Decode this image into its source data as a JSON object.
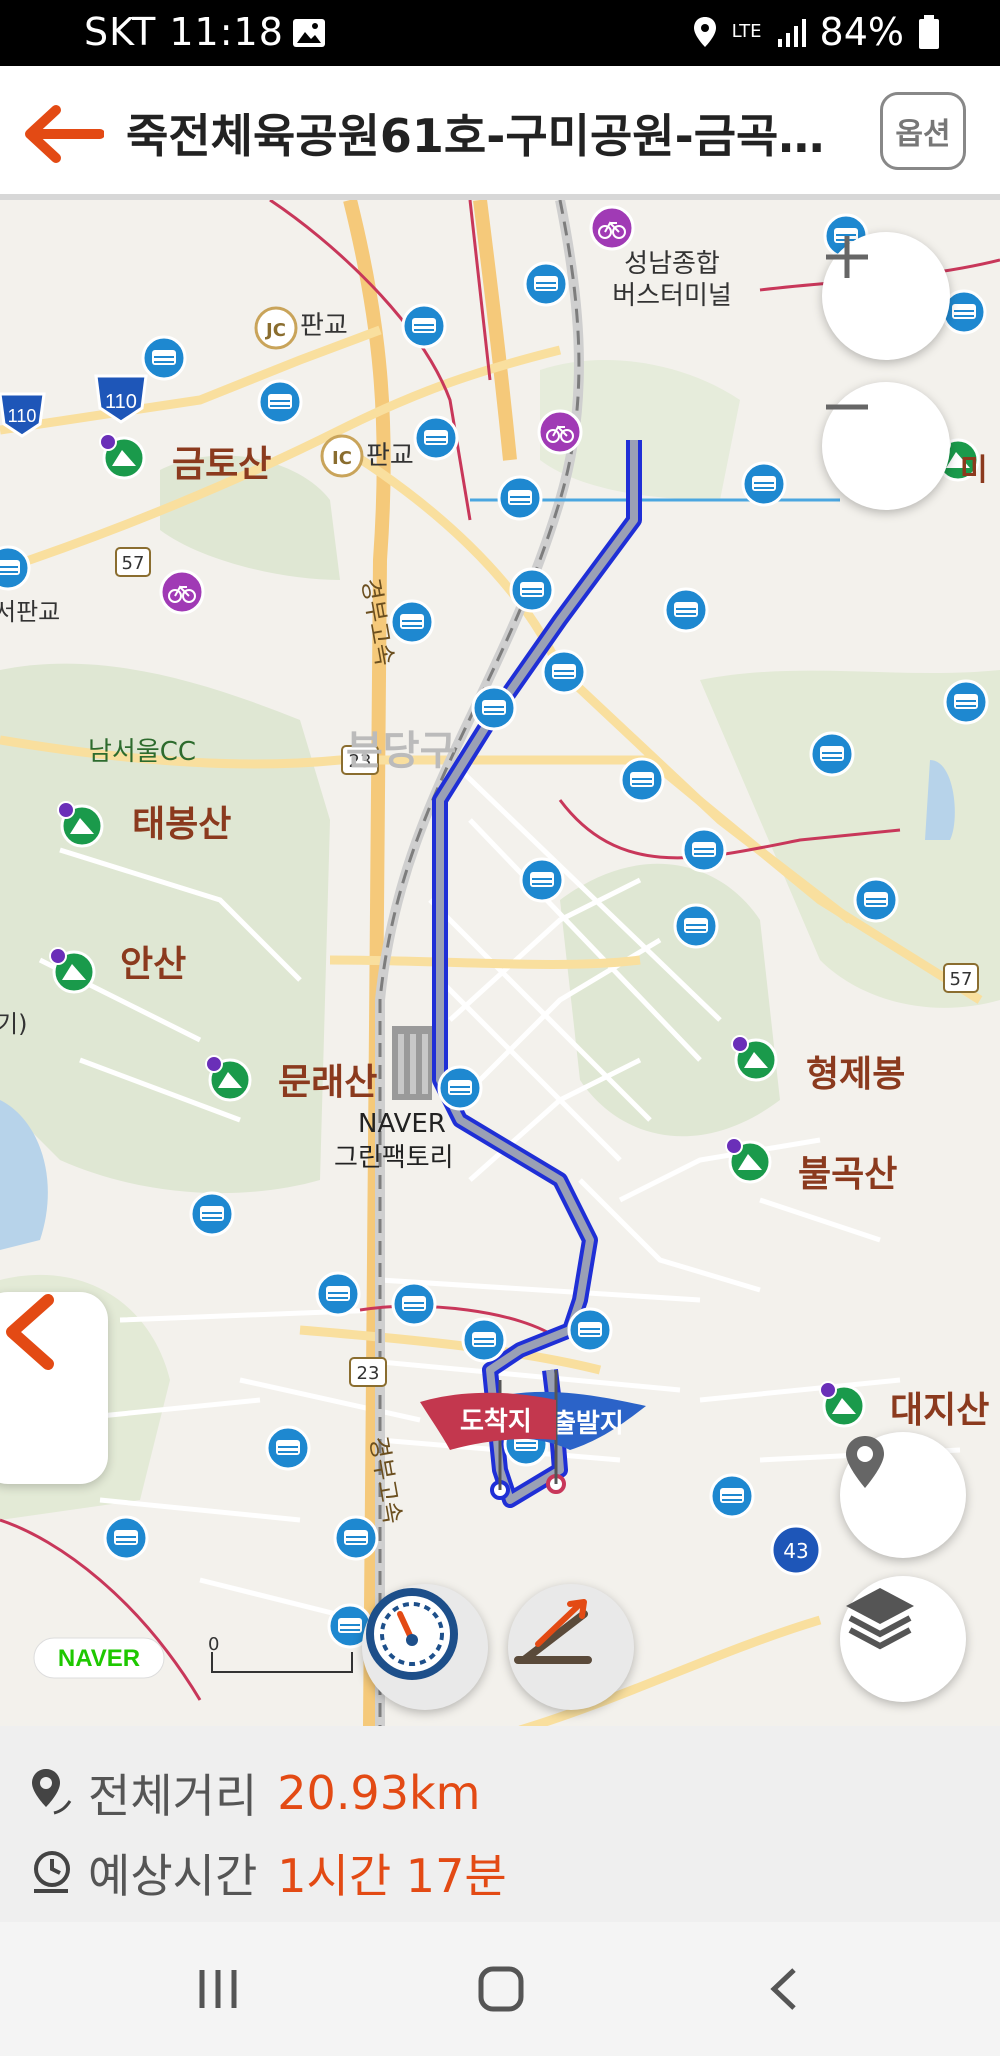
{
  "status_bar": {
    "carrier_time": "SKT 11:18",
    "network": "LTE",
    "battery": "84%"
  },
  "header": {
    "title": "죽전체육공원61호-구미공원-금곡…",
    "option_label": "옵션"
  },
  "map": {
    "labels": {
      "terminal": "성남종합",
      "terminal2": "버스터미널",
      "pangyo_jc": "판교",
      "pangyo_ic": "판교",
      "geumtosan": "금토산",
      "seopangyo": "서판교",
      "namseoul_cc": "남서울CC",
      "taebongsan": "태봉산",
      "ansan": "안산",
      "bundang": "분당구",
      "munraesan": "문래산",
      "naver": "NAVER",
      "greenfactory": "그린팩토리",
      "hyeongjebong": "형제봉",
      "bulgoksan": "불곡산",
      "daejisan": "대지산",
      "expressway": "경부고속",
      "expressway2": "경부고속",
      "road_57a": "57",
      "road_57b": "57",
      "road_23a": "23",
      "road_23b": "23",
      "road_43": "43",
      "road_110a": "110",
      "road_110b": "110",
      "jc": "JC",
      "ic": "IC",
      "arrival": "도착지",
      "departure": "출발지",
      "partial_left": "기)",
      "partial_right_mi": "미",
      "naver_logo": "NAVER",
      "scale": "0"
    }
  },
  "info": {
    "distance_label": "전체거리",
    "distance_value": "20.93km",
    "time_label": "예상시간",
    "time_value": "1시간 17분"
  },
  "colors": {
    "accent": "#e34a14",
    "route": "#1f2fd6",
    "bus_stop": "#1e88d0",
    "bike": "#a03ab5",
    "mountain": "#1a9a4b"
  }
}
